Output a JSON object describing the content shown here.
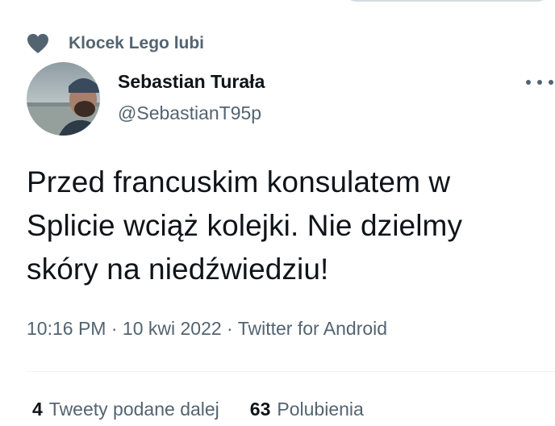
{
  "social_context": {
    "icon": "heart-icon",
    "text": "Klocek Lego lubi"
  },
  "author": {
    "name": "Sebastian Turała",
    "handle": "@SebastianT95p",
    "avatar": "avatar-photo"
  },
  "tweet": {
    "lines": [
      "Przed francuskim konsulatem w",
      "Splicie wciąż kolejki. Nie dzielmy",
      "skóry na niedźwiedziu!"
    ],
    "time": "10:16 PM",
    "date": "10 kwi 2022",
    "separator": "·",
    "source": "Twitter for Android"
  },
  "stats": {
    "retweets_count": "4",
    "retweets_label": "Tweety podane dalej",
    "likes_count": "63",
    "likes_label": "Polubienia"
  },
  "colors": {
    "primary_text": "#0f1419",
    "secondary_text": "#536471",
    "divider": "#eff3f4"
  }
}
